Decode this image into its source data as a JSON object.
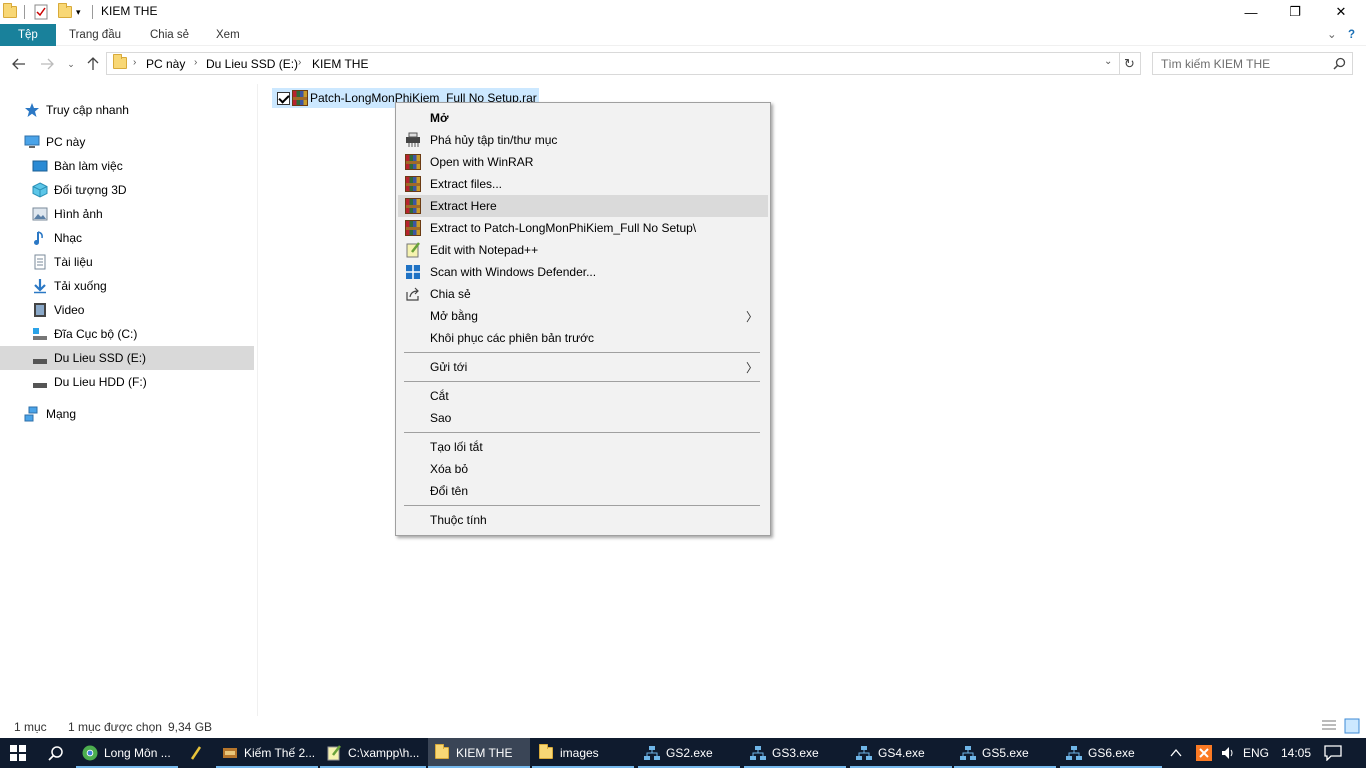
{
  "window": {
    "title": "KIEM THE",
    "minimize": "—",
    "restore": "❐",
    "close": "✕"
  },
  "ribbon": {
    "tabs": [
      "Tệp",
      "Trang đầu",
      "Chia sẻ",
      "Xem"
    ]
  },
  "address": {
    "segments": [
      "PC này",
      "Du Lieu SSD (E:)",
      "KIEM THE"
    ]
  },
  "search": {
    "placeholder": "Tìm kiếm KIEM THE"
  },
  "sidebar": {
    "items": [
      {
        "label": "Truy cập nhanh",
        "icon": "star-icon"
      },
      {
        "label": "PC này",
        "icon": "computer-icon"
      },
      {
        "label": "Bàn làm việc",
        "icon": "desktop-icon"
      },
      {
        "label": "Đối tượng 3D",
        "icon": "cube-icon"
      },
      {
        "label": "Hình ảnh",
        "icon": "pictures-icon"
      },
      {
        "label": "Nhạc",
        "icon": "music-icon"
      },
      {
        "label": "Tài liệu",
        "icon": "document-icon"
      },
      {
        "label": "Tải xuống",
        "icon": "download-icon"
      },
      {
        "label": "Video",
        "icon": "video-icon"
      },
      {
        "label": "Đĩa Cục bộ (C:)",
        "icon": "drive-icon"
      },
      {
        "label": "Du Lieu SSD (E:)",
        "icon": "drive-icon"
      },
      {
        "label": "Du Lieu HDD (F:)",
        "icon": "drive-icon"
      },
      {
        "label": "Mạng",
        "icon": "network-icon"
      }
    ]
  },
  "file": {
    "name": "Patch-LongMonPhiKiem_Full No Setup.rar"
  },
  "context_menu": {
    "items": [
      {
        "label": "Mở",
        "icon": ""
      },
      {
        "label": "Phá hủy tập tin/thư mục",
        "icon": "shredder-icon"
      },
      {
        "label": "Open with WinRAR",
        "icon": "winrar-icon"
      },
      {
        "label": "Extract files...",
        "icon": "winrar-icon"
      },
      {
        "label": "Extract Here",
        "icon": "winrar-icon"
      },
      {
        "label": "Extract to Patch-LongMonPhiKiem_Full No Setup\\",
        "icon": "winrar-icon"
      },
      {
        "label": "Edit with Notepad++",
        "icon": "notepad-plus-icon"
      },
      {
        "label": "Scan with Windows Defender...",
        "icon": "defender-icon"
      },
      {
        "label": "Chia sẻ",
        "icon": "share-icon"
      },
      {
        "label": "Mở bằng",
        "icon": ""
      },
      {
        "label": "Khôi phục các phiên bản trước",
        "icon": ""
      },
      {
        "label": "Gửi tới",
        "icon": ""
      },
      {
        "label": "Cắt",
        "icon": ""
      },
      {
        "label": "Sao",
        "icon": ""
      },
      {
        "label": "Tạo lối tắt",
        "icon": ""
      },
      {
        "label": "Xóa bỏ",
        "icon": ""
      },
      {
        "label": "Đổi tên",
        "icon": ""
      },
      {
        "label": "Thuộc tính",
        "icon": ""
      }
    ],
    "highlighted": "Extract Here"
  },
  "status": {
    "count": "1 mục",
    "selected": "1 mục được chọn",
    "size": "9,34 GB"
  },
  "taskbar": {
    "items": [
      {
        "label": "Long Môn ...",
        "icon": "chrome-icon"
      },
      {
        "label": "",
        "icon": "pen-icon"
      },
      {
        "label": "Kiếm Thế 2...",
        "icon": "game-icon"
      },
      {
        "label": "C:\\xampp\\h...",
        "icon": "notepad-icon"
      },
      {
        "label": "KIEM THE",
        "icon": "folder-icon"
      },
      {
        "label": "images",
        "icon": "folder-icon"
      },
      {
        "label": "GS2.exe",
        "icon": "network-app-icon"
      },
      {
        "label": "GS3.exe",
        "icon": "network-app-icon"
      },
      {
        "label": "GS4.exe",
        "icon": "network-app-icon"
      },
      {
        "label": "GS5.exe",
        "icon": "network-app-icon"
      },
      {
        "label": "GS6.exe",
        "icon": "network-app-icon"
      }
    ],
    "language": "ENG",
    "time": "14:05"
  },
  "colors": {
    "ribbon_active": "#19819b",
    "selection": "#cce8ff",
    "taskbar": "#0f1b2e"
  }
}
